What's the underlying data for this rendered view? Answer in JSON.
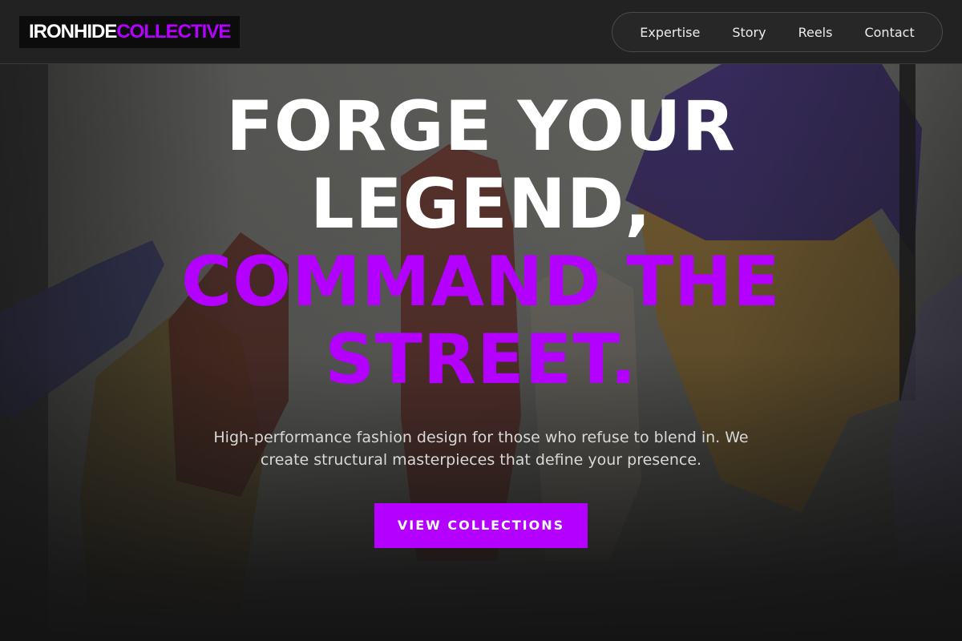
{
  "header": {
    "logo": {
      "part1": "IRONHIDE",
      "part2": "COLLECTIVE"
    },
    "nav": [
      {
        "label": "Expertise"
      },
      {
        "label": "Story"
      },
      {
        "label": "Reels"
      },
      {
        "label": "Contact"
      }
    ]
  },
  "hero": {
    "title_lines": [
      "FORGE YOUR",
      "LEGEND,",
      "COMMAND THE",
      "STREET."
    ],
    "subtitle": "High-performance fashion design for those who refuse to blend in. We create structural masterpieces that define your presence.",
    "cta_label": "VIEW COLLECTIONS",
    "background_image": "garments-hanging-on-rack-photo"
  },
  "colors": {
    "accent": "#b400ff",
    "header_bg": "#222222",
    "page_bg": "#141414",
    "text_primary": "#ffffff"
  }
}
